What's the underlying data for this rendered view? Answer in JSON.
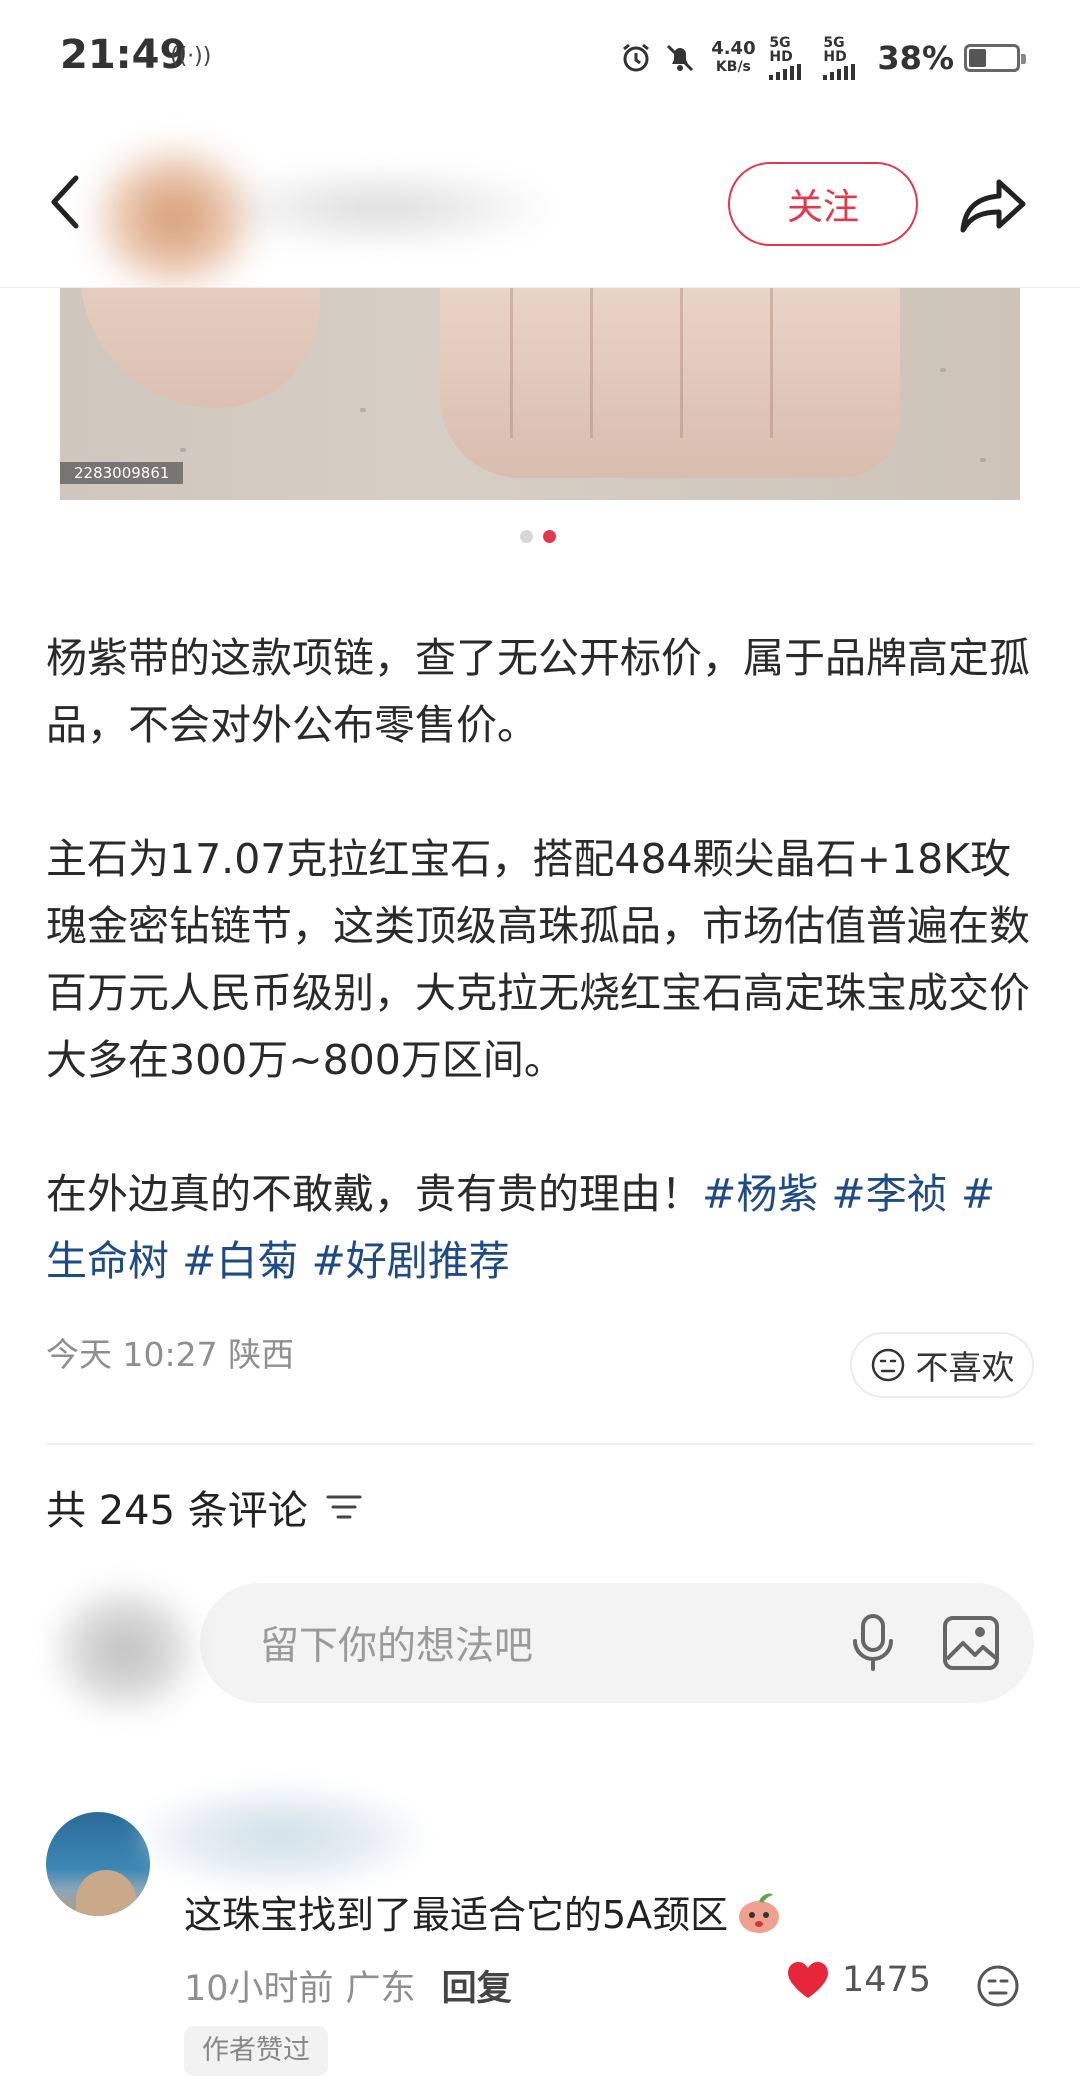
{
  "status_bar": {
    "time": "21:49",
    "net_speed_value": "4.40",
    "net_speed_unit": "KB/s",
    "net_type_1": "5G HD",
    "net_type_2": "5G HD",
    "battery_text": "38%",
    "battery_level": 0.38
  },
  "header": {
    "follow_label": "关注"
  },
  "carousel": {
    "image_id": "2283009861",
    "page_count": 2,
    "active_index": 1
  },
  "post": {
    "paragraph1": "杨紫带的这款项链，查了无公开标价，属于品牌高定孤品，不会对外公布零售价。",
    "paragraph2": "主石为17.07克拉红宝石，搭配484颗尖晶石+18K玫瑰金密钻链节，这类顶级高珠孤品，市场估值普遍在数百万元人民币级别，大克拉无烧红宝石高定珠宝成交价大多在300万~800万区间。",
    "paragraph3_text": "在外边真的不敢戴，贵有贵的理由！",
    "tags": [
      "#杨紫",
      "#李祯",
      "#生命树",
      "#白菊",
      "#好剧推荐"
    ],
    "time": "今天 10:27",
    "location": "陕西",
    "dislike_label": "不喜欢"
  },
  "comments": {
    "title": "共 245 条评论",
    "input_placeholder": "留下你的想法吧",
    "items": [
      {
        "text": "这珠宝找到了最适合它的5A颈区",
        "time": "10小时前",
        "location": "广东",
        "reply_label": "回复",
        "likes": "1475",
        "badge": "作者赞过"
      }
    ]
  },
  "colors": {
    "accent": "#e0394c",
    "tag": "#1e4b86",
    "meta_gray": "#8f8f8f"
  }
}
